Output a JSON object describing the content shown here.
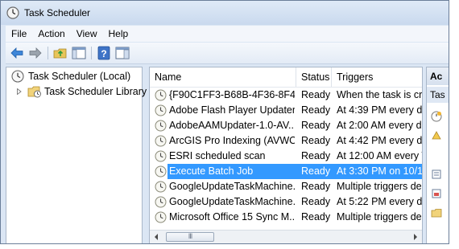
{
  "window": {
    "title": "Task Scheduler"
  },
  "menu": [
    "File",
    "Action",
    "View",
    "Help"
  ],
  "toolbar": {
    "icons": [
      "back-arrow-icon",
      "forward-arrow-icon",
      "up-folder-icon",
      "show-hide-tree-icon",
      "help-icon",
      "show-hide-action-pane-icon"
    ]
  },
  "tree": {
    "root": "Task Scheduler (Local)",
    "library": "Task Scheduler Library"
  },
  "table": {
    "columns": [
      "Name",
      "Status",
      "Triggers"
    ],
    "rows": [
      {
        "name": "{F90C1FF3-B68B-4F36-8F44...",
        "status": "Ready",
        "trigger": "When the task is cr"
      },
      {
        "name": "Adobe Flash Player Updater",
        "status": "Ready",
        "trigger": "At 4:39 PM every da"
      },
      {
        "name": "AdobeAAMUpdater-1.0-AV...",
        "status": "Ready",
        "trigger": "At 2:00 AM every da"
      },
      {
        "name": "ArcGIS Pro Indexing (AVWO...",
        "status": "Ready",
        "trigger": "At 4:42 PM every da"
      },
      {
        "name": "ESRI scheduled scan",
        "status": "Ready",
        "trigger": "At 12:00 AM every T"
      },
      {
        "name": "Execute Batch Job",
        "status": "Ready",
        "trigger": "At 3:30 PM on 10/1",
        "selected": true
      },
      {
        "name": "GoogleUpdateTaskMachine...",
        "status": "Ready",
        "trigger": "Multiple triggers de"
      },
      {
        "name": "GoogleUpdateTaskMachine...",
        "status": "Ready",
        "trigger": "At 5:22 PM every da"
      },
      {
        "name": "Microsoft Office 15 Sync M...",
        "status": "Ready",
        "trigger": "Multiple triggers de"
      }
    ],
    "scroll_thumb_glyph": "III"
  },
  "actions": {
    "header": "Ac",
    "subheader": "Tas"
  },
  "colors": {
    "selection": "#3399ff",
    "chrome": "#dbe6f4"
  }
}
